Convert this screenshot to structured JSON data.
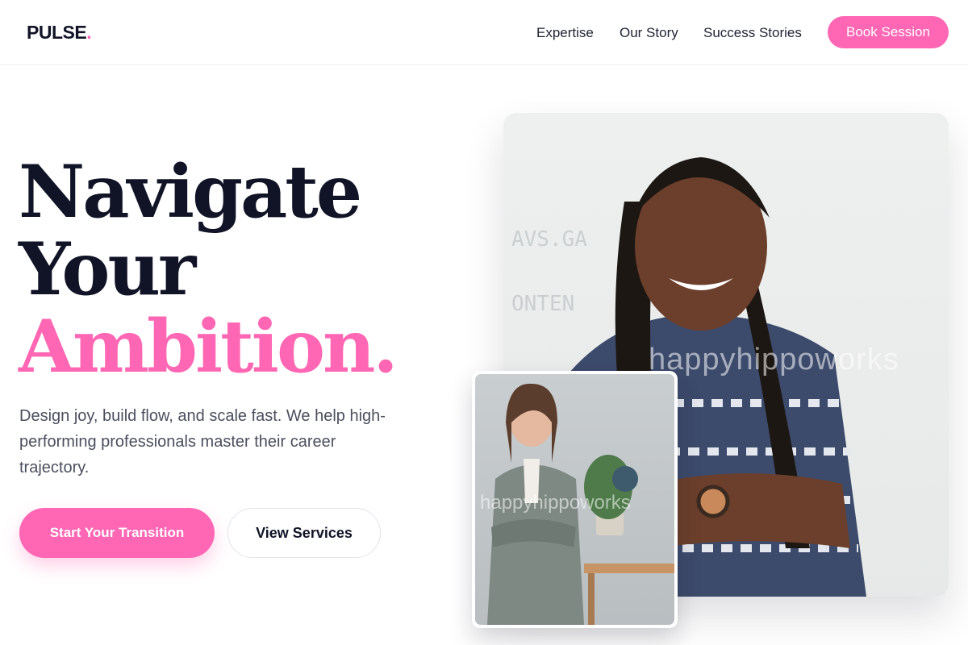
{
  "header": {
    "logo_text": "PULSE",
    "logo_dot": ".",
    "nav": [
      {
        "label": "Expertise"
      },
      {
        "label": "Our Story"
      },
      {
        "label": "Success Stories"
      }
    ],
    "cta_label": "Book Session"
  },
  "hero": {
    "headline_line1": "Navigate",
    "headline_line2": "Your",
    "headline_accent": "Ambition.",
    "subtext": "Design joy, build flow, and scale fast. We help high-performing professionals master their career trajectory.",
    "primary_cta": "Start Your Transition",
    "secondary_cta": "View Services"
  },
  "images": {
    "main_watermark": "happyhippoworks",
    "inset_watermark": "happyhippoworks"
  },
  "colors": {
    "accent": "#ff66b3",
    "heading": "#111427",
    "body_text": "#4b4f5e"
  }
}
